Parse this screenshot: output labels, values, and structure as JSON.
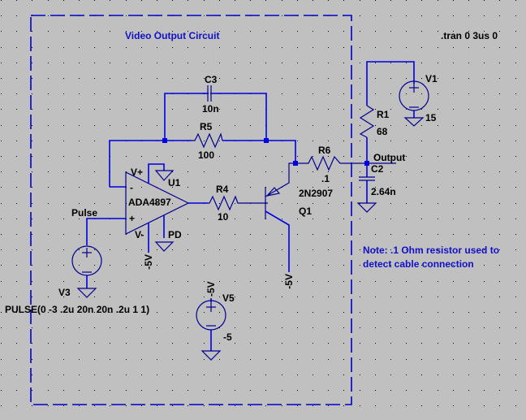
{
  "title": "Video Output Circuit",
  "directive": ".tran 0 3us 0",
  "note_lines": [
    "Note: .1 Ohm resistor used to",
    "detect cable connection"
  ],
  "components": {
    "C3": {
      "name": "C3",
      "value": "10n"
    },
    "R5": {
      "name": "R5",
      "value": "100"
    },
    "U1": {
      "name": "U1",
      "model": "ADA4897",
      "pins": {
        "vplus": "V+",
        "vminus": "V-",
        "inv": "-",
        "noninv": "+",
        "pd": "PD"
      }
    },
    "R4": {
      "name": "R4",
      "value": "10"
    },
    "R6": {
      "name": "R6",
      "value": ".1"
    },
    "Q1": {
      "name": "Q1",
      "model": "2N2907"
    },
    "R1": {
      "name": "R1",
      "value": "68"
    },
    "V1": {
      "name": "V1",
      "value": "15"
    },
    "C2": {
      "name": "C2",
      "value": "2.64n"
    },
    "V3": {
      "name": "V3",
      "value": "PULSE(0 -3 .2u 20n 20n .2u 1 1)"
    },
    "V5": {
      "name": "V5",
      "value": "-5"
    }
  },
  "net_labels": {
    "output": "Output",
    "pulse": "Pulse",
    "neg5_opamp": "-5V",
    "neg5_q1": "-5V",
    "neg5_v5": "-5V"
  },
  "colors": {
    "background": "#c0c0c0",
    "wire": "#0000e0",
    "text": "#000000",
    "comment": "#1010c8"
  }
}
